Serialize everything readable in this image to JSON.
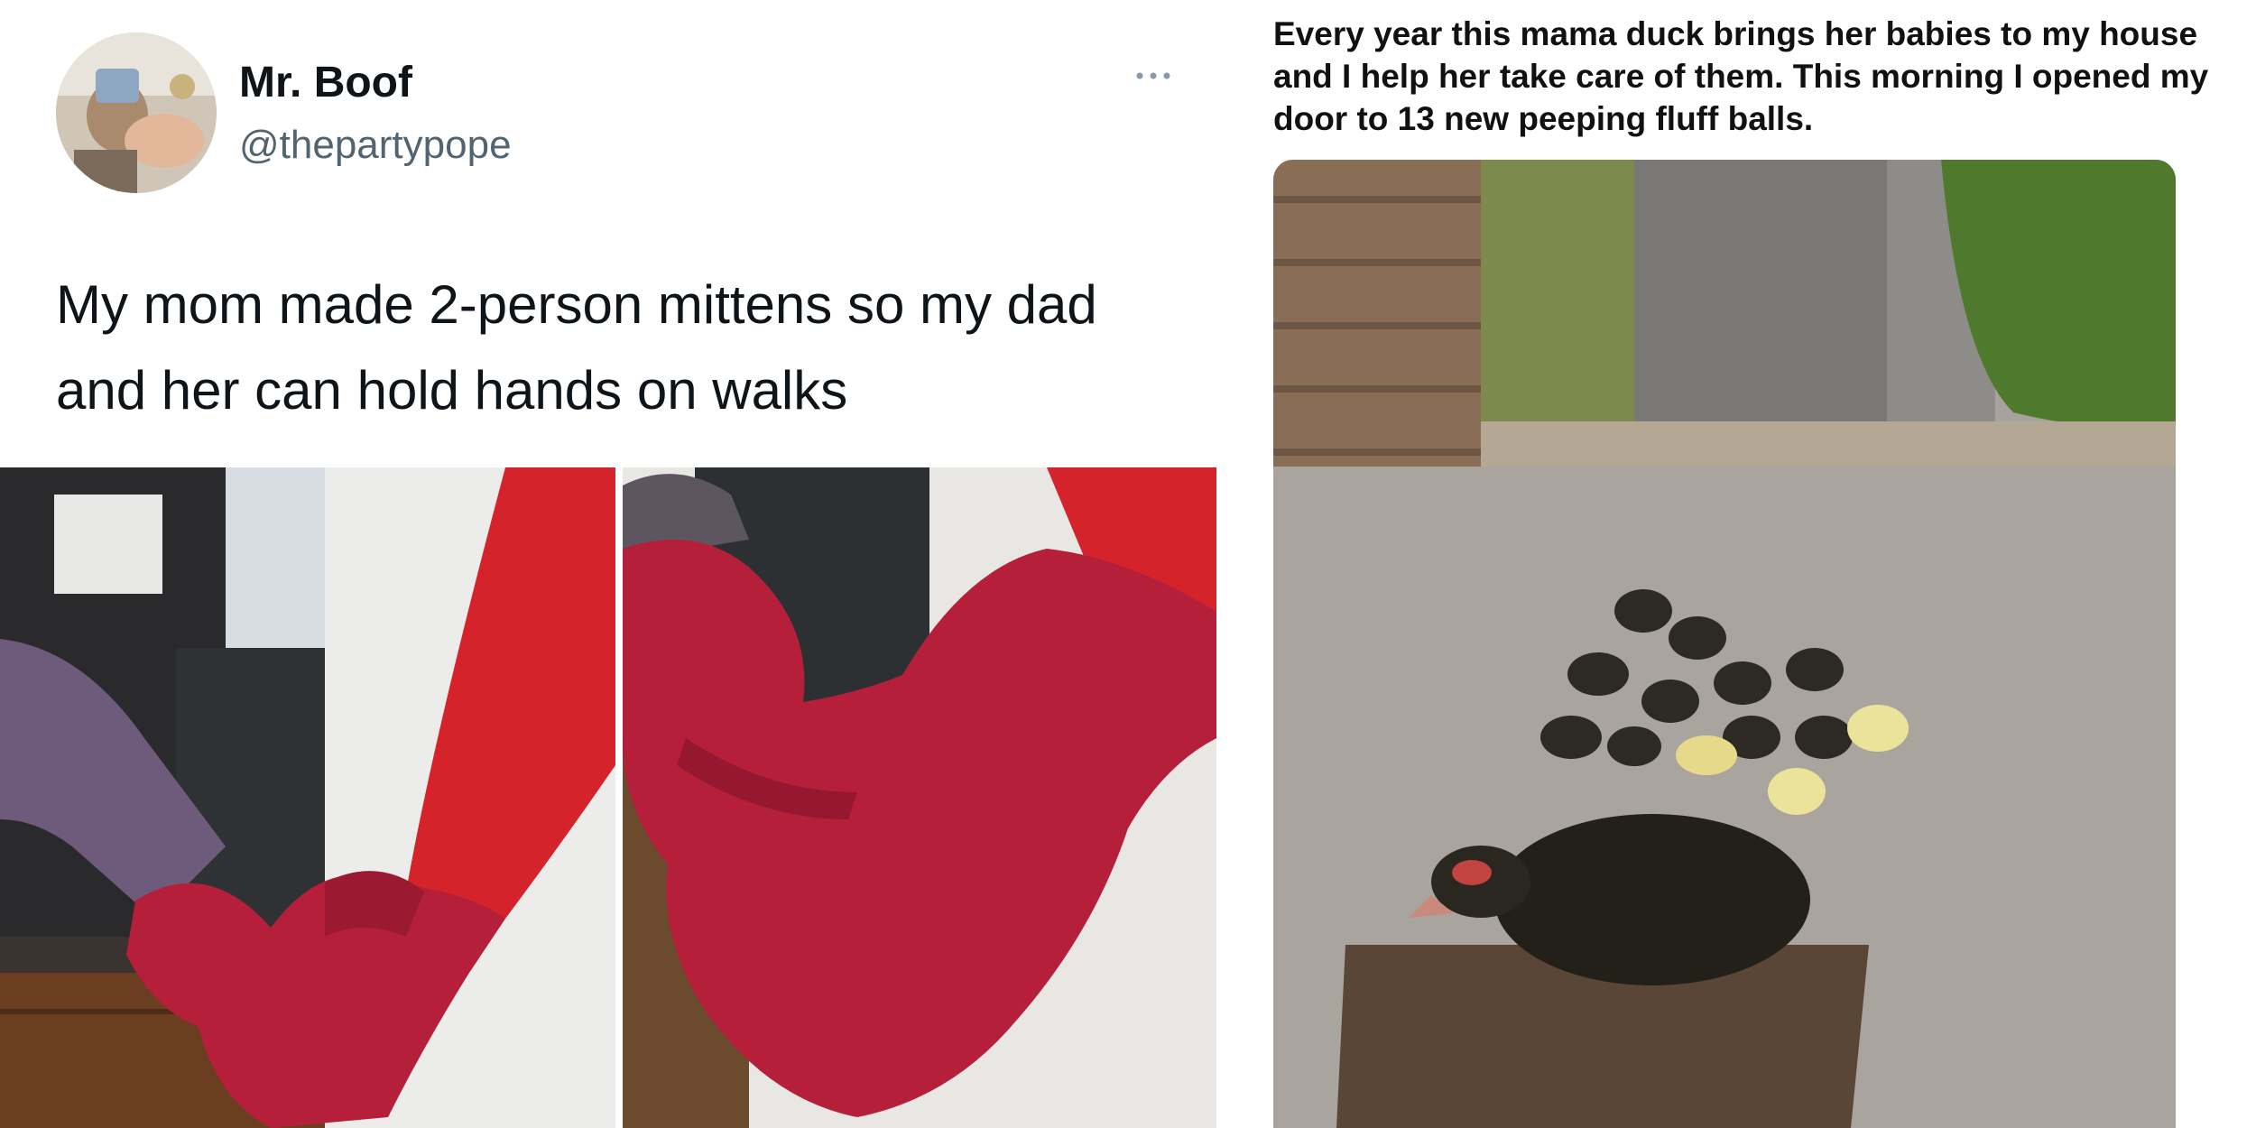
{
  "left_tweet": {
    "author": {
      "display_name": "Mr. Boof",
      "handle": "@thepartypope"
    },
    "text": "My mom made 2-person mittens so my dad and her can hold hands on walks",
    "photos": [
      {
        "subject": "red knitted two-person mitten holding two hands"
      },
      {
        "subject": "close-up of red knitted two-person mitten"
      }
    ]
  },
  "right_post": {
    "caption": "Every year this mama duck brings her babies to my house and I help her take care of them. This morning I opened my door to 13 new peeping fluff balls.",
    "photo": {
      "subject": "mama duck with ducklings on front porch doormat"
    }
  },
  "icons": {
    "more": "more-options-icon"
  },
  "colors": {
    "text_primary": "#0f1419",
    "text_secondary": "#536471",
    "mitten_red": "#b51f3a"
  }
}
